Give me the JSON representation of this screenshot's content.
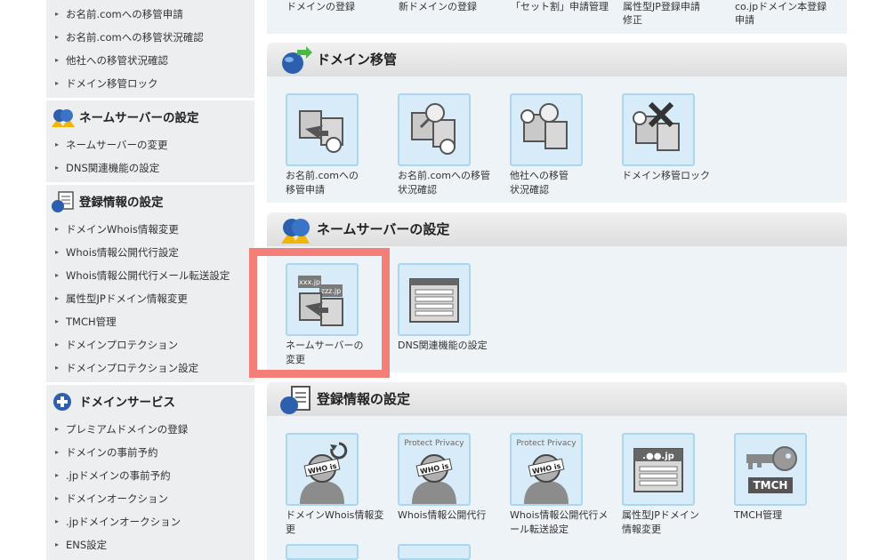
{
  "sidebar": {
    "transfer_links": [
      "お名前.comへの移管申請",
      "お名前.comへの移管状況確認",
      "他社への移管状況確認",
      "ドメイン移管ロック"
    ],
    "ns_head": "ネームサーバーの設定",
    "ns_links": [
      "ネームサーバーの変更",
      "DNS関連機能の設定"
    ],
    "reg_head": "登録情報の設定",
    "reg_links": [
      "ドメインWhois情報変更",
      "Whois情報公開代行設定",
      "Whois情報公開代行メール転送設定",
      "属性型JPドメイン情報変更",
      "TMCH管理",
      "ドメインプロテクション",
      "ドメインプロテクション設定"
    ],
    "svc_head": "ドメインサービス",
    "svc_links": [
      "プレミアムドメインの登録",
      "ドメインの事前予約",
      ".jpドメインの事前予約",
      "ドメインオークション",
      ".jpドメインオークション",
      "ENS設定"
    ]
  },
  "top_row": {
    "labels": [
      "ドメインの登録",
      "新ドメインの登録",
      "「セット割」申請管理",
      "属性型JP登録申請\n修正",
      "co.jpドメイン本登録\n申請"
    ]
  },
  "sections": {
    "transfer": {
      "title": "ドメイン移管",
      "tiles": [
        {
          "label": "お名前.comへの\n移管申請",
          "icon": "transfer-request-icon"
        },
        {
          "label": "お名前.comへの移管\n状況確認",
          "icon": "transfer-status-icon"
        },
        {
          "label": "他社への移管\n状況確認",
          "icon": "transfer-out-status-icon"
        },
        {
          "label": "ドメイン移管ロック",
          "icon": "transfer-lock-icon"
        }
      ]
    },
    "nameserver": {
      "title": "ネームサーバーの設定",
      "tiles": [
        {
          "label": "ネームサーバーの\n変更",
          "icon": "nameserver-change-icon",
          "badge1": "xxx.jp",
          "badge2": "zzz.jp"
        },
        {
          "label": "DNS関連機能の設定",
          "icon": "dns-settings-icon"
        }
      ]
    },
    "registration": {
      "title": "登録情報の設定",
      "tiles": [
        {
          "label": "ドメインWhois情報変\n更",
          "icon": "whois-change-icon",
          "who": "WHO is"
        },
        {
          "label": "Whois情報公開代行",
          "icon": "whois-privacy-icon",
          "caption": "Protect Privacy",
          "who": "WHO is"
        },
        {
          "label": "Whois情報公開代行メ\nール転送設定",
          "icon": "whois-mail-forward-icon",
          "caption": "Protect Privacy",
          "who": "WHO is"
        },
        {
          "label": "属性型JPドメイン\n情報変更",
          "icon": "jp-domain-info-icon",
          "badge": ".●●.jp"
        },
        {
          "label": "TMCH管理",
          "icon": "tmch-key-icon",
          "badge": "TMCH"
        }
      ]
    }
  },
  "colors": {
    "highlight": "#f47f78",
    "tile_bg": "#d7ecf8",
    "tile_border": "#a9d6f1"
  }
}
